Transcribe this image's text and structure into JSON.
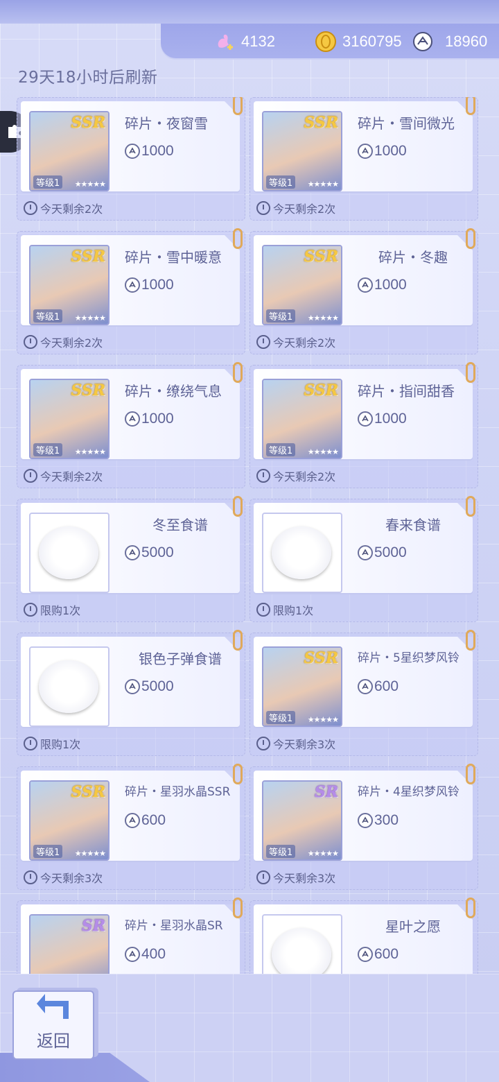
{
  "currencies": [
    {
      "icon": "swan-plus-icon",
      "value": "4132"
    },
    {
      "icon": "gold-coin-icon",
      "value": "3160795"
    },
    {
      "icon": "silver-coin-icon",
      "value": "18960"
    }
  ],
  "refresh_text": "29天18小时后刷新",
  "items": [
    {
      "name": "碎片・夜窗雪",
      "price": "1000",
      "limit": "今天剩余2次",
      "rarity": "SSR",
      "level": "等级1",
      "kind": "card"
    },
    {
      "name": "碎片・雪间微光",
      "price": "1000",
      "limit": "今天剩余2次",
      "rarity": "SSR",
      "level": "等级1",
      "kind": "card"
    },
    {
      "name": "碎片・雪中暖意",
      "price": "1000",
      "limit": "今天剩余2次",
      "rarity": "SSR",
      "level": "等级1",
      "kind": "card"
    },
    {
      "name": "碎片・冬趣",
      "price": "1000",
      "limit": "今天剩余2次",
      "rarity": "SSR",
      "level": "等级1",
      "kind": "card"
    },
    {
      "name": "碎片・缭绕气息",
      "price": "1000",
      "limit": "今天剩余2次",
      "rarity": "SSR",
      "level": "等级1",
      "kind": "card"
    },
    {
      "name": "碎片・指间甜香",
      "price": "1000",
      "limit": "今天剩余2次",
      "rarity": "SSR",
      "level": "等级1",
      "kind": "card"
    },
    {
      "name": "冬至食谱",
      "price": "5000",
      "limit": "限购1次",
      "kind": "item"
    },
    {
      "name": "春来食谱",
      "price": "5000",
      "limit": "限购1次",
      "kind": "item"
    },
    {
      "name": "银色子弹食谱",
      "price": "5000",
      "limit": "限购1次",
      "kind": "item"
    },
    {
      "name": "碎片・5星织梦风铃",
      "price": "600",
      "limit": "今天剩余3次",
      "rarity": "SSR",
      "level": "等级1",
      "kind": "card"
    },
    {
      "name": "碎片・星羽水晶SSR",
      "price": "600",
      "limit": "今天剩余3次",
      "rarity": "SSR",
      "level": "等级1",
      "kind": "card"
    },
    {
      "name": "碎片・4星织梦风铃",
      "price": "300",
      "limit": "今天剩余3次",
      "rarity": "SR",
      "level": "等级1",
      "kind": "card"
    },
    {
      "name": "碎片・星羽水晶SR",
      "price": "400",
      "limit": "",
      "rarity": "SR",
      "level": "",
      "kind": "card"
    },
    {
      "name": "星叶之愿",
      "price": "600",
      "limit": "",
      "kind": "item"
    }
  ],
  "back_label": "返回",
  "colors": {
    "accent": "#9ea6ea",
    "ssr": "#f5c842",
    "sr": "#b58ce8"
  }
}
